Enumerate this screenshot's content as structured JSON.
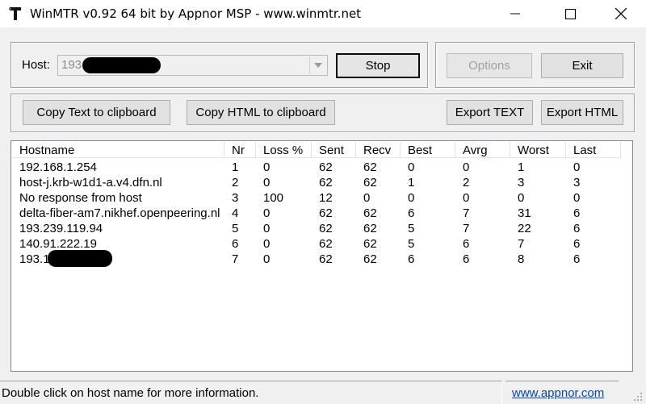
{
  "window": {
    "title": "WinMTR v0.92 64 bit by Appnor MSP - www.winmtr.net",
    "icon": "winmtr-app-icon",
    "controls": [
      "minimize-icon",
      "maximize-icon",
      "close-icon"
    ]
  },
  "host_group": {
    "host_label": "Host:",
    "host_value": "193.",
    "stop_label": "Stop"
  },
  "action_group": {
    "options_label": "Options",
    "exit_label": "Exit"
  },
  "export_group": {
    "copy_text_label": "Copy Text to clipboard",
    "copy_html_label": "Copy HTML to clipboard",
    "export_text_label": "Export TEXT",
    "export_html_label": "Export HTML"
  },
  "table": {
    "columns": [
      "Hostname",
      "Nr",
      "Loss %",
      "Sent",
      "Recv",
      "Best",
      "Avrg",
      "Worst",
      "Last"
    ],
    "rows": [
      [
        "192.168.1.254",
        "1",
        "0",
        "62",
        "62",
        "0",
        "0",
        "1",
        "0"
      ],
      [
        "host-j.krb-w1d1-a.v4.dfn.nl",
        "2",
        "0",
        "62",
        "62",
        "1",
        "2",
        "3",
        "3"
      ],
      [
        "No response from host",
        "3",
        "100",
        "12",
        "0",
        "0",
        "0",
        "0",
        "0"
      ],
      [
        "delta-fiber-am7.nikhef.openpeering.nl",
        "4",
        "0",
        "62",
        "62",
        "6",
        "7",
        "31",
        "6"
      ],
      [
        "193.239.119.94",
        "5",
        "0",
        "62",
        "62",
        "5",
        "7",
        "22",
        "6"
      ],
      [
        "140.91.222.19",
        "6",
        "0",
        "62",
        "62",
        "5",
        "6",
        "7",
        "6"
      ],
      [
        "193.1",
        "7",
        "0",
        "62",
        "62",
        "6",
        "6",
        "8",
        "6"
      ]
    ]
  },
  "status": {
    "message": "Double click on host name for more information.",
    "link": "www.appnor.com"
  }
}
